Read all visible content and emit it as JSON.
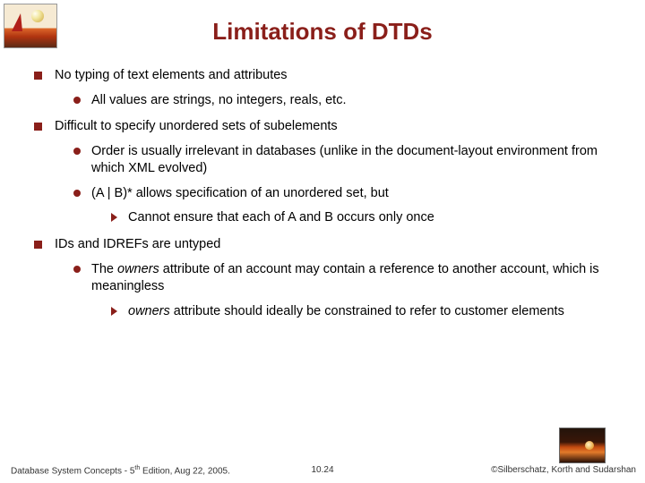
{
  "title": "Limitations of DTDs",
  "bullets": {
    "b1": "No typing of text elements and attributes",
    "b1_1": "All values are strings, no integers, reals, etc.",
    "b2": "Difficult to specify unordered sets of subelements",
    "b2_1": "Order is usually irrelevant in databases (unlike in the document-layout environment from which XML evolved)",
    "b2_2": "(A | B)* allows specification of an unordered set, but",
    "b2_2_1": "Cannot ensure that each of A and B occurs only once",
    "b3": "IDs and IDREFs are untyped",
    "b3_1_pre": "The ",
    "b3_1_em": "owners",
    "b3_1_post": " attribute of an account may contain a reference to another account, which is meaningless",
    "b3_1_1_em": "owners",
    "b3_1_1_post": " attribute should ideally be constrained to refer to customer elements"
  },
  "footer": {
    "left_pre": "Database System Concepts - 5",
    "left_sup": "th",
    "left_post": " Edition, Aug 22, 2005.",
    "center": "10.24",
    "right": "©Silberschatz, Korth and Sudarshan"
  }
}
